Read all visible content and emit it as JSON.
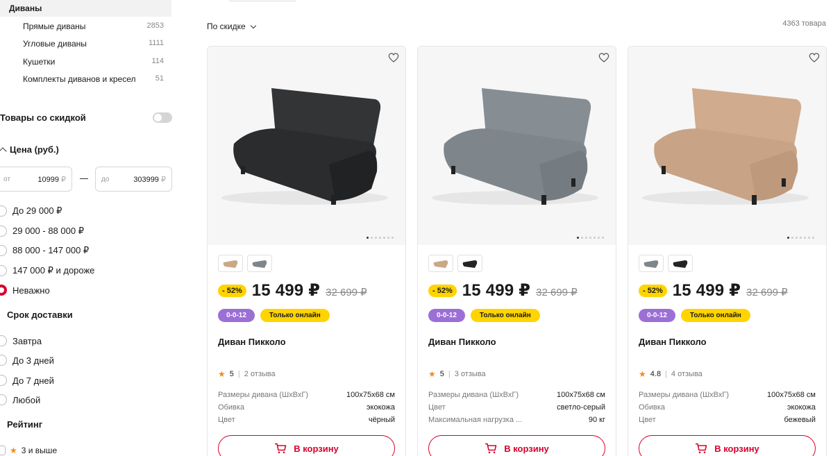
{
  "sidebar": {
    "category_head": "Диваны",
    "categories": [
      {
        "label": "Прямые диваны",
        "count": "2853"
      },
      {
        "label": "Угловые диваны",
        "count": "1111"
      },
      {
        "label": "Кушетки",
        "count": "114"
      },
      {
        "label": "Комплекты диванов и кресел",
        "count": "51"
      }
    ],
    "discount_toggle": "Товары со скидкой",
    "price_head": "Цена (руб.)",
    "price_from_label": "от",
    "price_from_value": "10999",
    "price_to_label": "до",
    "price_to_value": "303999",
    "currency": "₽",
    "price_options": [
      "До 29 000 ₽",
      "29 000 - 88 000 ₽",
      "88 000 - 147 000 ₽",
      "147 000 ₽ и дороже",
      "Неважно"
    ],
    "delivery_head": "Срок доставки",
    "delivery_options": [
      "Завтра",
      "До 3 дней",
      "До 7 дней",
      "Любой"
    ],
    "rating_head": "Рейтинг",
    "rating_option": "3 и выше"
  },
  "toolbar": {
    "sort_label": "По скидке",
    "count_label": "4363 товара"
  },
  "colors": {
    "accent": "#d9002b",
    "badge_yellow": "#ffd400",
    "badge_purple": "#9b6fd6"
  },
  "products": [
    {
      "discount": "- 52%",
      "price": "15 499 ₽",
      "old_price": "32 699 ₽",
      "badge_installment": "0-0-12",
      "badge_online": "Только онлайн",
      "title": "Диван Пикколо",
      "rating": "5",
      "reviews": "2 отзыва",
      "color": "#2a2c2e",
      "swatches": [
        "#c9a887",
        "#7f868b"
      ],
      "specs": [
        {
          "k": "Размеры дивана (ШхВхГ)",
          "v": "100х75х68 см"
        },
        {
          "k": "Обивка",
          "v": "экокожа"
        },
        {
          "k": "Цвет",
          "v": "чёрный"
        }
      ],
      "cart_label": "В корзину"
    },
    {
      "discount": "- 52%",
      "price": "15 499 ₽",
      "old_price": "32 699 ₽",
      "badge_installment": "0-0-12",
      "badge_online": "Только онлайн",
      "title": "Диван Пикколо",
      "rating": "5",
      "reviews": "3 отзыва",
      "color": "#7e868b",
      "swatches": [
        "#c9a887",
        "#222426"
      ],
      "specs": [
        {
          "k": "Размеры дивана (ШхВхГ)",
          "v": "100х75х68 см"
        },
        {
          "k": "Цвет",
          "v": "светло-серый"
        },
        {
          "k": "Максимальная нагрузка ...",
          "v": "90 кг"
        }
      ],
      "cart_label": "В корзину"
    },
    {
      "discount": "- 52%",
      "price": "15 499 ₽",
      "old_price": "32 699 ₽",
      "badge_installment": "0-0-12",
      "badge_online": "Только онлайн",
      "title": "Диван Пикколо",
      "rating": "4.8",
      "reviews": "4 отзыва",
      "color": "#c8a386",
      "swatches": [
        "#7f868b",
        "#222426"
      ],
      "specs": [
        {
          "k": "Размеры дивана (ШхВхГ)",
          "v": "100х75х68 см"
        },
        {
          "k": "Обивка",
          "v": "экокожа"
        },
        {
          "k": "Цвет",
          "v": "бежевый"
        }
      ],
      "cart_label": "В корзину"
    }
  ]
}
